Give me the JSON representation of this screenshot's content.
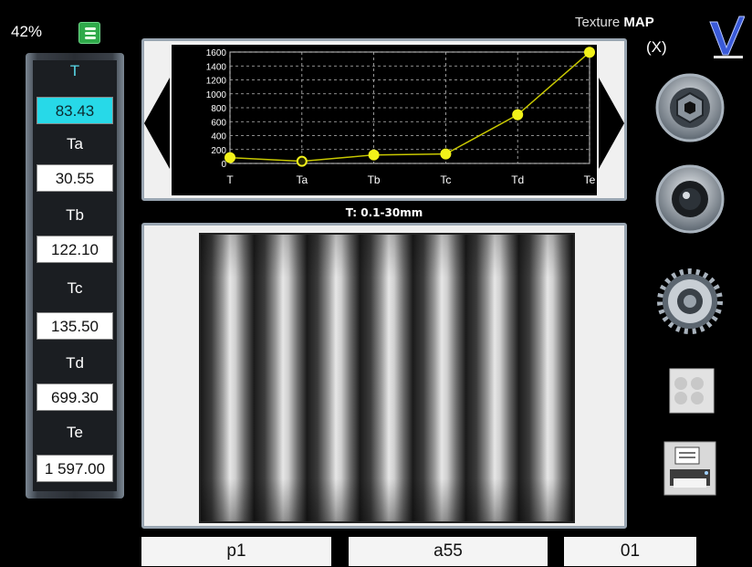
{
  "status": {
    "battery": "42%"
  },
  "header": {
    "title_prefix": "Texture",
    "title_bold": "MAP",
    "close_label": "(X)"
  },
  "left_panel": {
    "items": [
      {
        "label": "T",
        "value": "83.43",
        "active": true
      },
      {
        "label": "Ta",
        "value": "30.55",
        "active": false
      },
      {
        "label": "Tb",
        "value": "122.10",
        "active": false
      },
      {
        "label": "Tc",
        "value": "135.50",
        "active": false
      },
      {
        "label": "Td",
        "value": "699.30",
        "active": false
      },
      {
        "label": "Te",
        "value": "1 597.00",
        "active": false
      }
    ]
  },
  "chart_data": {
    "type": "line",
    "categories": [
      "T",
      "Ta",
      "Tb",
      "Tc",
      "Td",
      "Te"
    ],
    "values": [
      83.43,
      30.55,
      122.1,
      135.5,
      699.3,
      1597.0
    ],
    "ylim": [
      0,
      1600
    ],
    "yticks": [
      "0",
      "200",
      "400",
      "600",
      "800",
      "1000",
      "1200",
      "1400",
      "1600"
    ],
    "grid": true,
    "line_color": "#c8c800",
    "point_color": "#f2f21a"
  },
  "caption": "T: 0.1-30mm",
  "bottom_fields": {
    "field1": "p1",
    "field2": "a55",
    "field3": "01"
  },
  "icons": {
    "battery": "database-icon",
    "logo": "checkmark-logo-icon",
    "camera": "camera-shutter-icon",
    "lens": "camera-lens-icon",
    "settings": "gear-icon",
    "puzzle": "puzzle-icon",
    "printer": "printer-icon"
  }
}
